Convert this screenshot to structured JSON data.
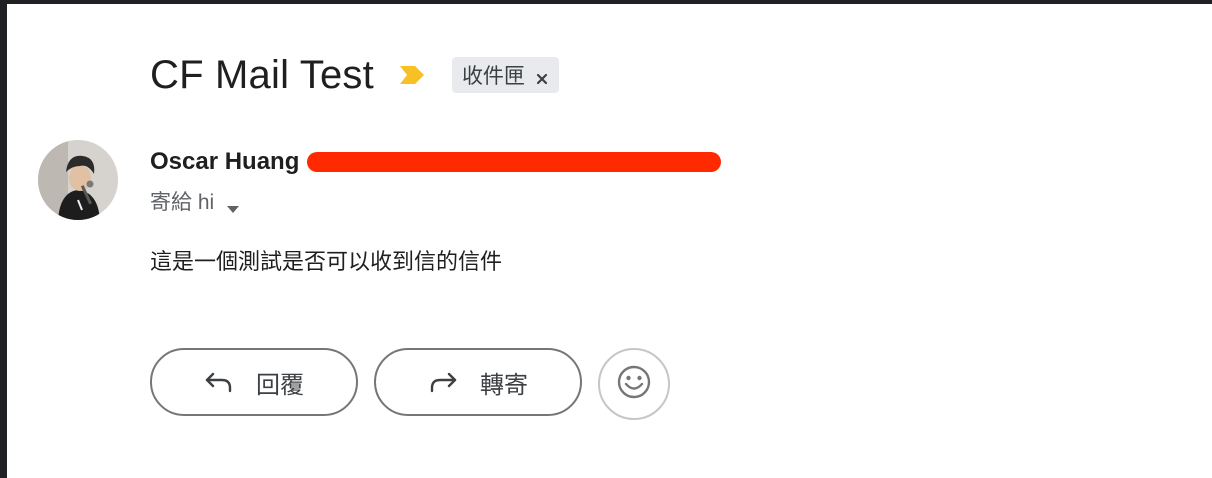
{
  "email": {
    "subject": "CF Mail Test",
    "label_chip": "收件匣",
    "sender_name": "Oscar Huang",
    "recipient_line": "寄給 hi",
    "body": "這是一個測試是否可以收到信的信件"
  },
  "actions": {
    "reply_label": "回覆",
    "forward_label": "轉寄"
  },
  "icons": {
    "importance": "importance-marker-icon",
    "chip_close": "close-icon",
    "recipient_dropdown": "caret-down-icon",
    "reply": "reply-arrow-icon",
    "forward": "forward-arrow-icon",
    "emoji": "smiley-icon"
  },
  "colors": {
    "importance_marker": "#f6c026",
    "redaction": "#ff2a00",
    "chip_background": "#e8eaed",
    "button_border": "#747775"
  }
}
